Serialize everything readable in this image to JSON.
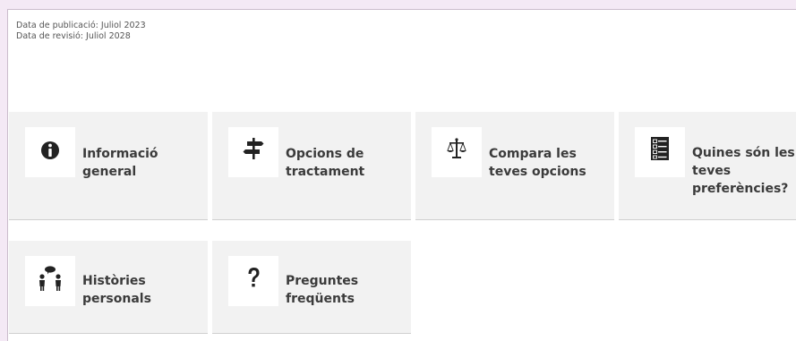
{
  "meta": {
    "publication_date": "Data de publicació: Juliol 2023",
    "revision_date": "Data de revisió: Juliol 2028"
  },
  "cards": [
    {
      "label": "Informació general",
      "icon": "info-icon"
    },
    {
      "label": "Opcions de tractament",
      "icon": "signpost-icon"
    },
    {
      "label": "Compara les teves opcions",
      "icon": "scales-icon"
    },
    {
      "label": "Quines són les teves preferències?",
      "icon": "checklist-icon"
    },
    {
      "label": "Històries personals",
      "icon": "people-talking-icon"
    },
    {
      "label": "Preguntes freqüents",
      "icon": "question-mark-icon"
    }
  ],
  "colors": {
    "page_background": "#f4e9f5",
    "card_background": "#f2f2f2",
    "icon_color": "#222222",
    "text_color": "#3b3b3b"
  }
}
